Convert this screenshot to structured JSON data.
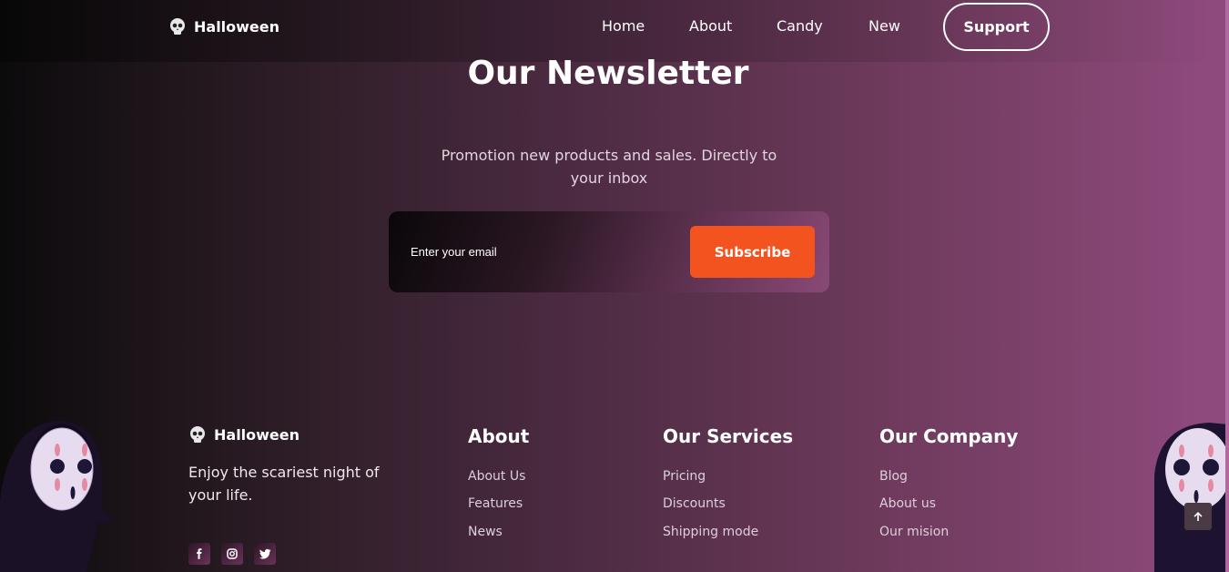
{
  "header": {
    "brand": "Halloween",
    "nav": [
      "Home",
      "About",
      "Candy",
      "New"
    ],
    "support_label": "Support"
  },
  "newsletter": {
    "title": "Our Newsletter",
    "subtitle": "Promotion new products and sales. Directly to your inbox",
    "email_placeholder": "Enter your email",
    "subscribe_label": "Subscribe"
  },
  "footer": {
    "brand": "Halloween",
    "tagline": "Enjoy the scariest night of your life.",
    "socials": [
      "facebook-icon",
      "instagram-icon",
      "twitter-icon"
    ],
    "columns": [
      {
        "title": "About",
        "links": [
          "About Us",
          "Features",
          "News"
        ]
      },
      {
        "title": "Our Services",
        "links": [
          "Pricing",
          "Discounts",
          "Shipping mode"
        ]
      },
      {
        "title": "Our Company",
        "links": [
          "Blog",
          "About us",
          "Our mision"
        ]
      }
    ]
  },
  "colors": {
    "accent": "#f3531f",
    "bg_left": "#0c0b0c",
    "bg_right": "#904b7e"
  },
  "icons": {
    "logo": "skull-icon",
    "scroll_top": "arrow-up-icon",
    "mascot": "ghost-mask-icon"
  }
}
